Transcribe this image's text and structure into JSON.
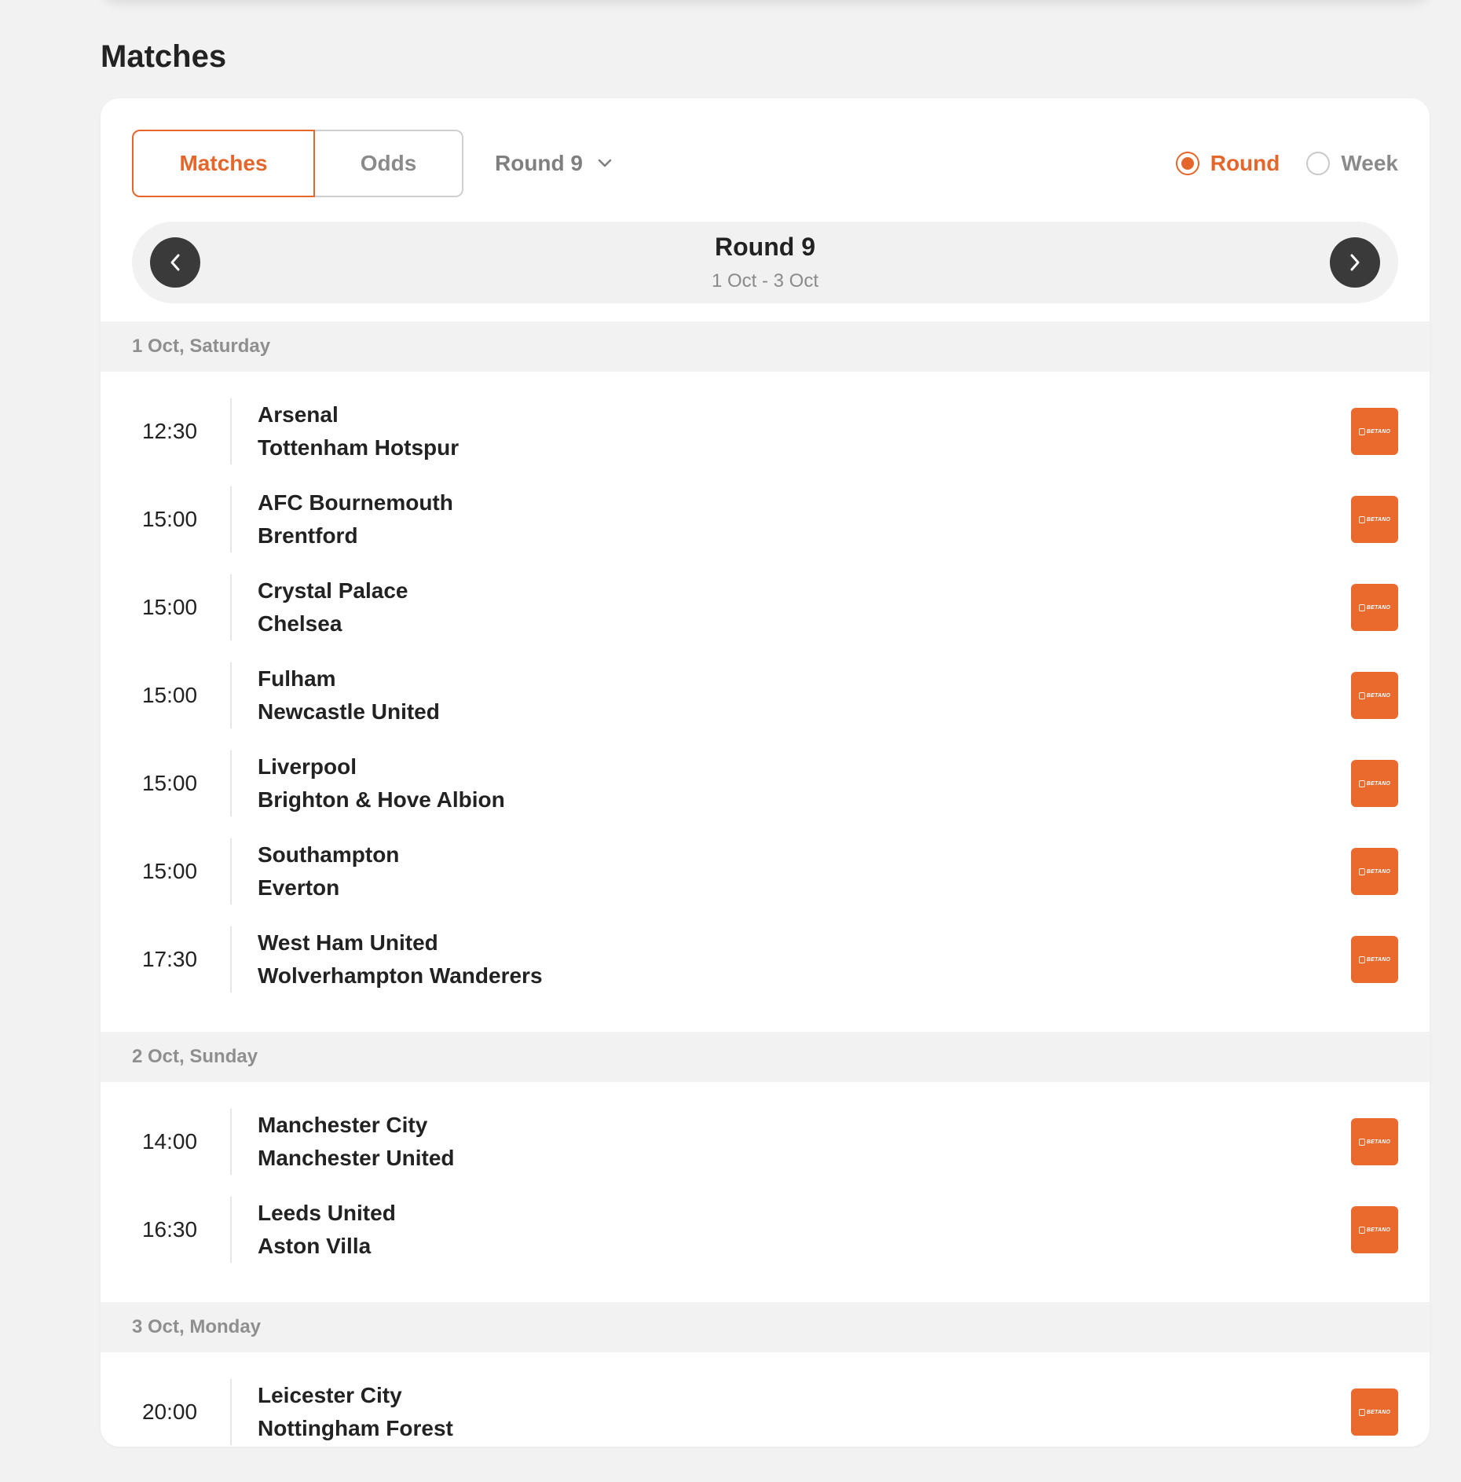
{
  "page": {
    "title": "Matches"
  },
  "tabs": {
    "matches": "Matches",
    "odds": "Odds"
  },
  "round_select": {
    "value": "Round 9"
  },
  "view_mode": {
    "round": "Round",
    "week": "Week",
    "selected": "round"
  },
  "round_nav": {
    "title": "Round 9",
    "dates": "1 Oct - 3 Oct"
  },
  "bookmaker": {
    "name": "BETANO",
    "color": "#e96a2c"
  },
  "colors": {
    "accent": "#e4662a",
    "background": "#f2f2f2",
    "card": "#ffffff"
  },
  "days": [
    {
      "label": "1 Oct, Saturday",
      "matches": [
        {
          "time": "12:30",
          "home": "Arsenal",
          "away": "Tottenham Hotspur"
        },
        {
          "time": "15:00",
          "home": "AFC Bournemouth",
          "away": "Brentford"
        },
        {
          "time": "15:00",
          "home": "Crystal Palace",
          "away": "Chelsea"
        },
        {
          "time": "15:00",
          "home": "Fulham",
          "away": "Newcastle United"
        },
        {
          "time": "15:00",
          "home": "Liverpool",
          "away": "Brighton & Hove Albion"
        },
        {
          "time": "15:00",
          "home": "Southampton",
          "away": "Everton"
        },
        {
          "time": "17:30",
          "home": "West Ham United",
          "away": "Wolverhampton Wanderers"
        }
      ]
    },
    {
      "label": "2 Oct, Sunday",
      "matches": [
        {
          "time": "14:00",
          "home": "Manchester City",
          "away": "Manchester United"
        },
        {
          "time": "16:30",
          "home": "Leeds United",
          "away": "Aston Villa"
        }
      ]
    },
    {
      "label": "3 Oct, Monday",
      "matches": [
        {
          "time": "20:00",
          "home": "Leicester City",
          "away": "Nottingham Forest"
        }
      ]
    }
  ]
}
